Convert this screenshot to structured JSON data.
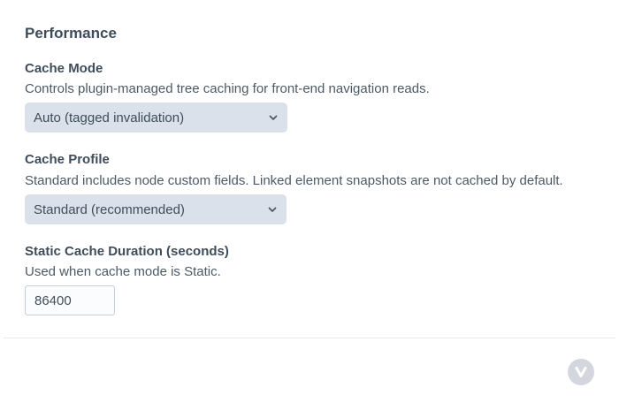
{
  "section": {
    "title": "Performance"
  },
  "cache_mode": {
    "label": "Cache Mode",
    "help": "Controls plugin-managed tree caching for front-end navigation reads.",
    "selected": "Auto (tagged invalidation)"
  },
  "cache_profile": {
    "label": "Cache Profile",
    "help": "Standard includes node custom fields. Linked element snapshots are not cached by default.",
    "selected": "Standard (recommended)"
  },
  "static_cache_duration": {
    "label": "Static Cache Duration (seconds)",
    "help": "Used when cache mode is Static.",
    "value": "86400"
  },
  "icons": {
    "select_chevron": "chevron-down-icon",
    "floating_button": "v-logo-icon"
  },
  "colors": {
    "select_background": "#dbe1ea",
    "text": "#3f4d5a",
    "floating_button": "#d3d7dd"
  }
}
